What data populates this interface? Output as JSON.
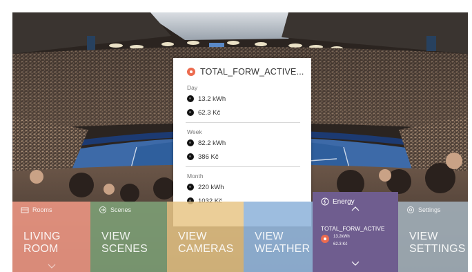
{
  "popup": {
    "title": "TOTAL_FORW_ACTIVE...",
    "sections": [
      {
        "label": "Day",
        "energy": "13.2 kWh",
        "cost": "62.3 Kč"
      },
      {
        "label": "Week",
        "energy": "82.2 kWh",
        "cost": "386 Kč"
      },
      {
        "label": "Month",
        "energy": "220 kWh",
        "cost": "1032 Kč"
      }
    ]
  },
  "tiles": {
    "rooms": {
      "header": "Rooms",
      "main": "LIVING ROOM",
      "color": "#ef9784"
    },
    "scenes": {
      "header": "Scenes",
      "main": "VIEW SCENES",
      "color": "#7d9e76"
    },
    "cameras": {
      "main": "VIEW CAMERAS",
      "color": "#e8c686"
    },
    "weather": {
      "main": "VIEW WEATHER",
      "color": "#92b6dc"
    },
    "energy": {
      "header": "Energy",
      "title": "TOTAL_FORW_ACTIVE",
      "value_energy": "13.2kWh",
      "value_cost": "62.3 Kč",
      "color": "#6f5d8f"
    },
    "settings": {
      "header": "Settings",
      "main": "VIEW SETTINGS",
      "color": "#a0acb6"
    }
  },
  "icons": [
    "bulb-icon",
    "rooms-icon",
    "scenes-icon",
    "energy-icon",
    "settings-icon",
    "chevron-up-icon",
    "chevron-down-icon"
  ]
}
